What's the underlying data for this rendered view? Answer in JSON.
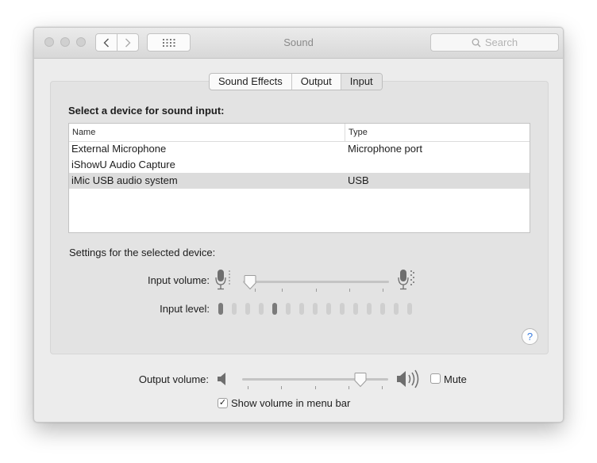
{
  "window": {
    "title": "Sound"
  },
  "toolbar": {
    "back_label": "‹",
    "forward_label": "›",
    "search_placeholder": "Search"
  },
  "tabs": [
    {
      "label": "Sound Effects"
    },
    {
      "label": "Output"
    },
    {
      "label": "Input",
      "selected": true
    }
  ],
  "input": {
    "heading": "Select a device for sound input:",
    "columns": [
      "Name",
      "Type"
    ],
    "devices": [
      {
        "name": "External Microphone",
        "type": "Microphone port"
      },
      {
        "name": "iShowU Audio Capture",
        "type": ""
      },
      {
        "name": "iMic USB audio system",
        "type": "USB",
        "selected": true
      }
    ],
    "settings_label": "Settings for the selected device:",
    "volume_label": "Input volume:",
    "volume_level": 0.05,
    "level_label": "Input level:",
    "level_leds_total": 15,
    "level_leds_lit": [
      1,
      5
    ]
  },
  "help_label": "?",
  "output": {
    "volume_label": "Output volume:",
    "volume_level": 0.81,
    "mute_label": "Mute",
    "mute_checked": false
  },
  "menubar_option": {
    "label": "Show volume in menu bar",
    "checked": true,
    "check_glyph": "✓"
  },
  "colors": {
    "window_bg": "#ececec",
    "panel_bg": "#e3e3e3",
    "selected_row": "#dcdcdc",
    "help_blue": "#3b7de0"
  }
}
